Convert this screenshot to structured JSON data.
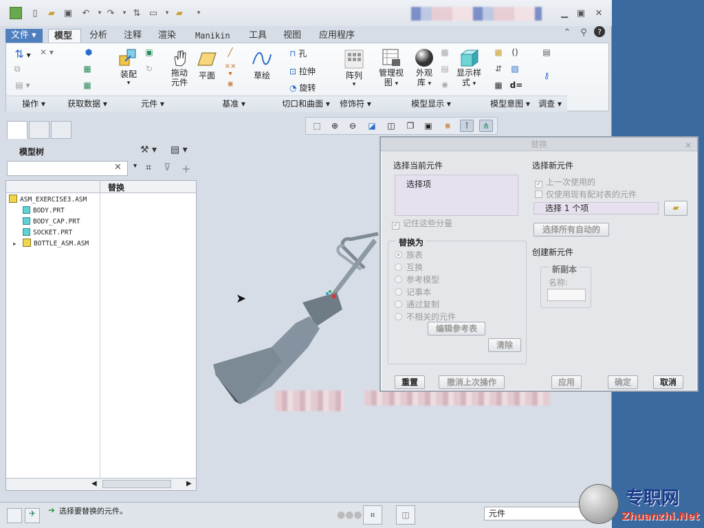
{
  "ribbon_tabs": [
    "文件",
    "模型",
    "分析",
    "注释",
    "渲染",
    "Manikin",
    "工具",
    "视图",
    "应用程序"
  ],
  "ribbon_buttons": {
    "assemble": "装配",
    "drag": "拖动\n元件",
    "plane": "平面",
    "sketch": "草绘",
    "hole": "孔",
    "extrude": "拉伸",
    "revolve": "旋转",
    "pattern": "阵列",
    "manage_views": "管理视\n图",
    "appearance": "外观\n库",
    "display_style": "显示样\n式",
    "d_eq": "d="
  },
  "ribbon_groups": [
    "操作",
    "获取数据",
    "元件",
    "基准",
    "切口和曲面",
    "修饰符",
    "模型显示",
    "模型意图",
    "调查"
  ],
  "model_tree": {
    "title": "模型树",
    "column": "替换",
    "items": [
      {
        "name": "ASM_EXERCISE3.ASM",
        "type": "asm",
        "indent": 0,
        "expander": ""
      },
      {
        "name": "BODY.PRT",
        "type": "part",
        "indent": 1,
        "expander": ""
      },
      {
        "name": "BODY_CAP.PRT",
        "type": "part",
        "indent": 1,
        "expander": ""
      },
      {
        "name": "SOCKET.PRT",
        "type": "part",
        "indent": 1,
        "expander": ""
      },
      {
        "name": "BOTTLE_ASM.ASM",
        "type": "asm",
        "indent": 1,
        "expander": "▶"
      }
    ]
  },
  "status": {
    "message": "选择要替换的元件。",
    "filter_value": "元件"
  },
  "dialog": {
    "title": "替换",
    "close": "×",
    "current_label": "选择当前元件",
    "current_item": "选择项",
    "remember": "记住这些分量",
    "replace_by": "替换为",
    "options": [
      "族表",
      "互换",
      "参考模型",
      "记事本",
      "通过复制",
      "不相关的元件"
    ],
    "edit_ref": "编辑参考表",
    "clear": "清除",
    "new_label": "选择新元件",
    "last_used": "上一次使用的",
    "only_pairs": "仅使用现有配对表的元件",
    "selected_count": "选择 1 个项",
    "select_all_auto": "选择所有自动的",
    "create_new": "创建新元件",
    "new_copy": "新副本",
    "name_label": "名称:",
    "reset": "重置",
    "undo_last": "撤消上次操作",
    "apply": "应用",
    "ok": "确定",
    "cancel": "取消"
  },
  "watermark": {
    "cn": "专职网",
    "en": "Zhuanzhi.Net"
  }
}
